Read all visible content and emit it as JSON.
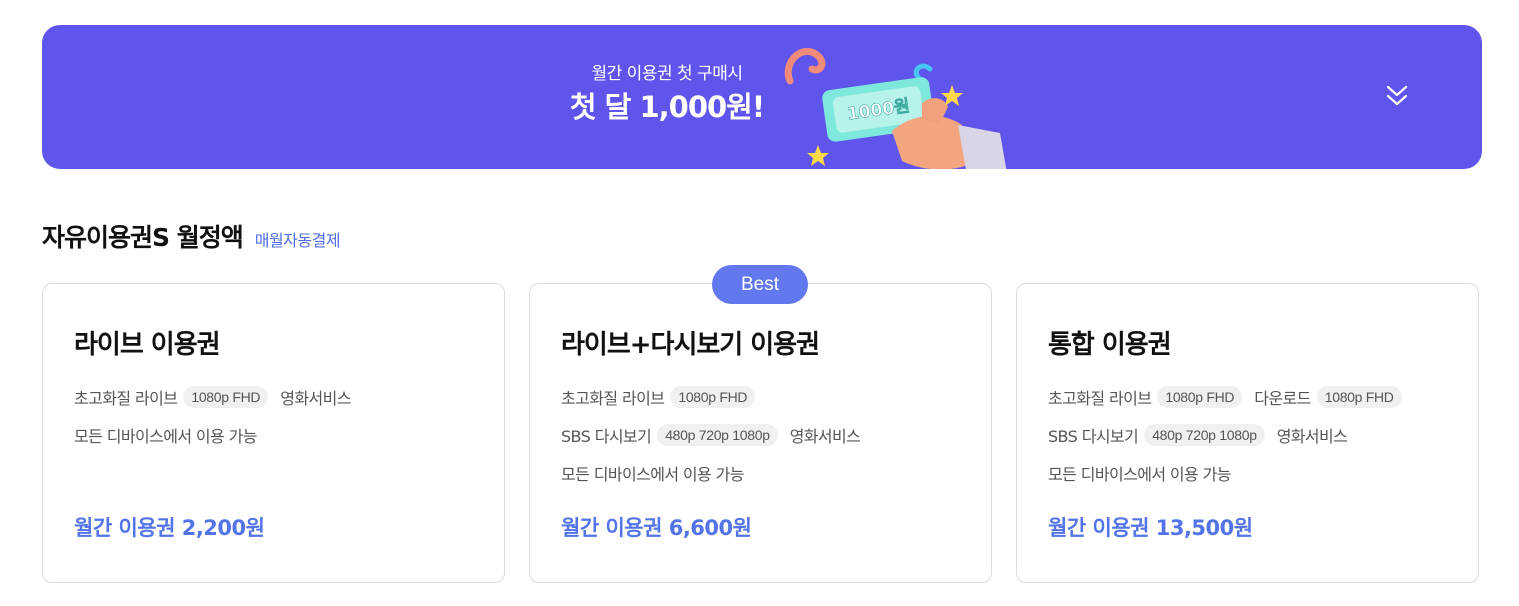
{
  "banner": {
    "subtitle": "월간 이용권 첫 구매시",
    "headline": "첫 달 1,000원!",
    "ticket_label": "1000원",
    "bg_color": "#5f55ec",
    "expand_icon": "double-chevron-down-icon"
  },
  "section": {
    "title": "자유이용권S 월정액",
    "billing_note": "매월자동결제"
  },
  "cards": [
    {
      "title": "라이브 이용권",
      "rows": [
        {
          "items": [
            {
              "text": "초고화질 라이브"
            },
            {
              "chip": "1080p FHD"
            },
            {
              "text": "영화서비스"
            }
          ]
        },
        {
          "items": [
            {
              "text": "모든 디바이스에서 이용 가능"
            }
          ]
        }
      ],
      "price": "월간 이용권 2,200원"
    },
    {
      "badge": "Best",
      "title": "라이브+다시보기 이용권",
      "rows": [
        {
          "items": [
            {
              "text": "초고화질 라이브"
            },
            {
              "chip": "1080p FHD"
            }
          ]
        },
        {
          "items": [
            {
              "text": "SBS 다시보기"
            },
            {
              "chip": "480p 720p 1080p"
            },
            {
              "text": "영화서비스"
            }
          ]
        },
        {
          "items": [
            {
              "text": "모든 디바이스에서 이용 가능"
            }
          ]
        }
      ],
      "price": "월간 이용권 6,600원"
    },
    {
      "title": "통합 이용권",
      "rows": [
        {
          "items": [
            {
              "text": "초고화질 라이브"
            },
            {
              "chip": "1080p FHD"
            },
            {
              "text": "다운로드"
            },
            {
              "chip": "1080p FHD"
            }
          ]
        },
        {
          "items": [
            {
              "text": "SBS 다시보기"
            },
            {
              "chip": "480p 720p 1080p"
            },
            {
              "text": "영화서비스"
            }
          ]
        },
        {
          "items": [
            {
              "text": "모든 디바이스에서 이용 가능"
            }
          ]
        }
      ],
      "price": "월간 이용권 13,500원"
    }
  ],
  "colors": {
    "accent": "#5374e8",
    "badge": "#6278ee",
    "chip_bg": "#f0f0f0"
  }
}
